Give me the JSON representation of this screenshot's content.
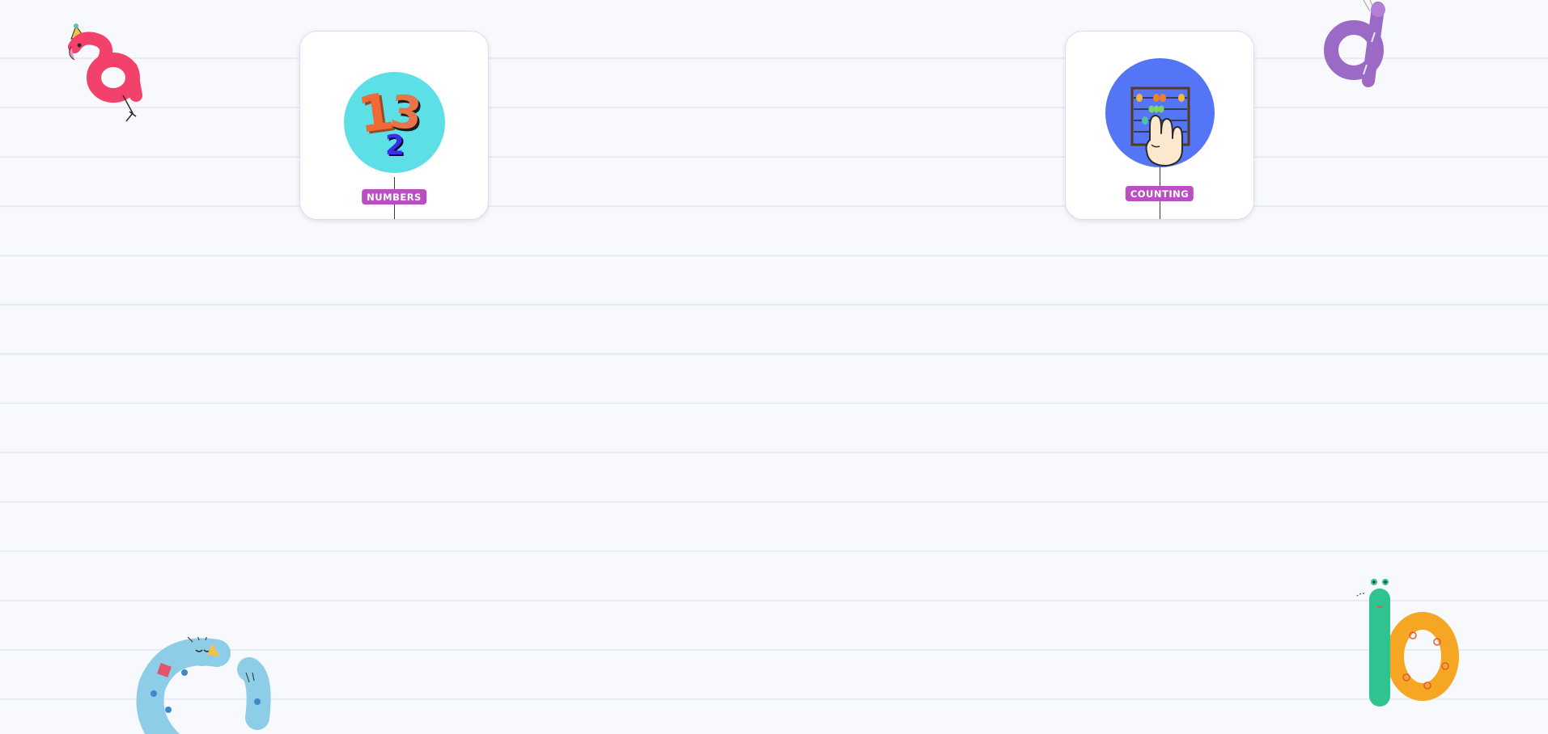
{
  "page": {
    "background": "#f7f9fc",
    "ruled_line_color": "#e6eaf4"
  },
  "cards": [
    {
      "id": "numbers",
      "label": "NUMBERS",
      "icon": "numbers-123-icon",
      "circle_color": "#5ce0e6",
      "label_color": "#b94fc0"
    },
    {
      "id": "counting",
      "label": "COUNTING",
      "icon": "abacus-hand-icon",
      "circle_color": "#5475f5",
      "label_color": "#b94fc0"
    }
  ],
  "decorations": [
    {
      "name": "flamingo-letter-a-icon",
      "color": "#f2416b"
    },
    {
      "name": "purple-letter-d-icon",
      "color": "#9b6ac7"
    },
    {
      "name": "cat-letter-c-icon",
      "color": "#8ecde8"
    },
    {
      "name": "snake-letter-b-icon",
      "color": "#f5a623"
    }
  ]
}
